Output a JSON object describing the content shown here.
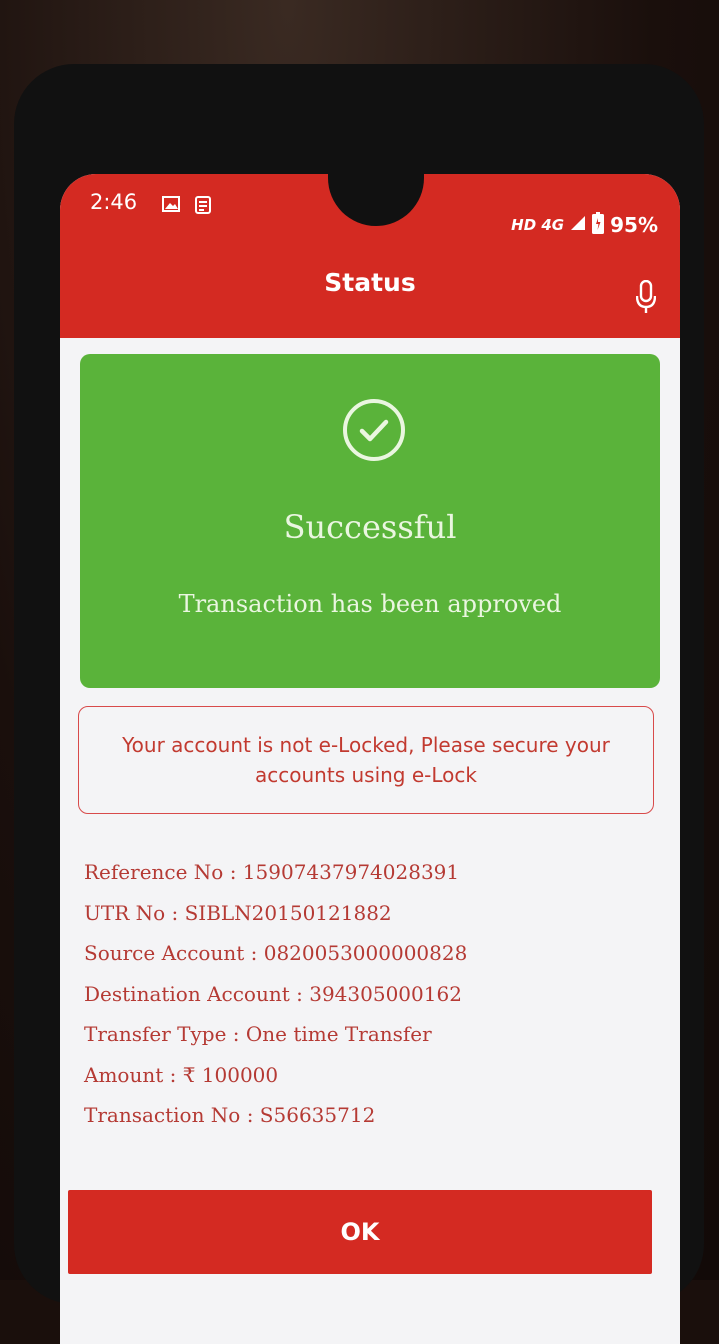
{
  "status_bar": {
    "time": "2:46",
    "network": "HD 4G",
    "battery": "95%"
  },
  "header": {
    "title": "Status"
  },
  "result": {
    "title": "Successful",
    "message": "Transaction has been approved"
  },
  "elock_notice": "Your account is not e-Locked, Please secure your accounts using e-Lock",
  "details": [
    "Reference No : 15907437974028391",
    "UTR No : SIBLN20150121882",
    "Source Account : 0820053000000828",
    "Destination Account : 394305000162",
    "Transfer Type : One time Transfer",
    "Amount : ₹ 100000",
    "Transaction No : S56635712"
  ],
  "ok_label": "OK",
  "colors": {
    "brand_red": "#d42a22",
    "success_green": "#5ab33a",
    "text_red": "#b53a34"
  },
  "icons": [
    "gallery-icon",
    "news-icon",
    "signal-icon",
    "battery-icon",
    "microphone-icon",
    "check-circle-icon"
  ]
}
